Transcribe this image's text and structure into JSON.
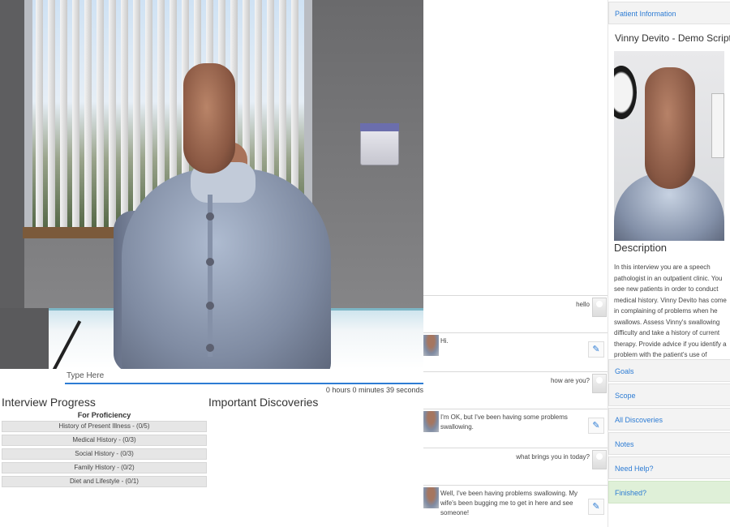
{
  "input": {
    "placeholder": "Type Here"
  },
  "timer": "0 hours 0 minutes 39 seconds",
  "progress": {
    "title": "Interview Progress",
    "proficiency_label": "For Proficiency",
    "rows": [
      "History of Present Illness - (0/5)",
      "Medical History - (0/3)",
      "Social History - (0/3)",
      "Family History - (0/2)",
      "Diet and Lifestyle - (0/1)"
    ]
  },
  "discoveries": {
    "title": "Important Discoveries"
  },
  "chat": [
    {
      "role": "user",
      "text": "hello"
    },
    {
      "role": "bot",
      "text": "Hi."
    },
    {
      "role": "user",
      "text": "how are you?"
    },
    {
      "role": "bot",
      "text": "I'm OK, but I've been having some problems swallowing."
    },
    {
      "role": "user",
      "text": "what brings you in today?"
    },
    {
      "role": "bot",
      "text": "Well, I've been having problems swallowing. My wife's been bugging me to get in here and see someone!"
    }
  ],
  "panel": {
    "patient_info_tab": "Patient Information",
    "patient_name": "Vinny Devito - Demo Script",
    "description_title": "Description",
    "description": "In this interview you are a speech pathologist in an outpatient clinic. You see new patients in order to conduct medical history. Vinny Devito has come in complaining of problems when he swallows. Assess Vinny's swallowing difficulty and take a history of current therapy. Provide advice if you identify a problem with the patient's use of medication or lifestyle.",
    "menu": [
      "Goals",
      "Scope",
      "All Discoveries",
      "Notes",
      "Need Help?",
      "Finished?"
    ]
  },
  "colors": {
    "accent": "#2d7cd4",
    "finished_bg": "#dff0d8",
    "row_bg": "#e6e6e6"
  },
  "icons": {
    "edit": "pencil-icon",
    "user_avatar": "user-avatar-icon"
  }
}
